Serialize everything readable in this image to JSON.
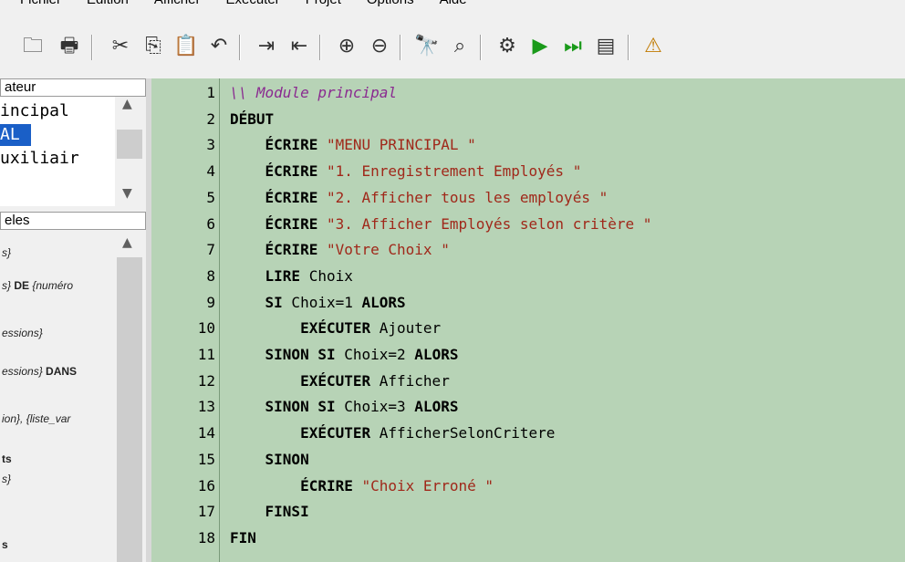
{
  "menubar": {
    "items": [
      "Fichier",
      "Édition",
      "Afficher",
      "Exécuter",
      "Projet",
      "Options",
      "Aide"
    ]
  },
  "toolbar": {
    "buttons": [
      {
        "icon": "open-folder-icon",
        "glyph": "🗀"
      },
      {
        "icon": "print-icon",
        "glyph": "🖶"
      },
      {
        "icon": "cut-icon",
        "glyph": "✂"
      },
      {
        "icon": "copy-icon",
        "glyph": "⎘"
      },
      {
        "icon": "paste-icon",
        "glyph": "📋"
      },
      {
        "icon": "undo-icon",
        "glyph": "↶"
      },
      {
        "icon": "indent-icon",
        "glyph": "⇥"
      },
      {
        "icon": "outdent-icon",
        "glyph": "⇤"
      },
      {
        "icon": "zoom-in-icon",
        "glyph": "⊕"
      },
      {
        "icon": "zoom-out-icon",
        "glyph": "⊖"
      },
      {
        "icon": "find-icon",
        "glyph": "🔭"
      },
      {
        "icon": "replace-icon",
        "glyph": "⌕"
      },
      {
        "icon": "compile-icon",
        "glyph": "⚙"
      },
      {
        "icon": "run-icon",
        "glyph": "▶"
      },
      {
        "icon": "step-icon",
        "glyph": "⏭"
      },
      {
        "icon": "output-icon",
        "glyph": "▤"
      },
      {
        "icon": "help-icon",
        "glyph": "⚠"
      }
    ]
  },
  "left": {
    "list1_header": "ateur",
    "list1_items": [
      "incipal",
      "AL",
      "uxiliair",
      ""
    ],
    "list2_header": "eles",
    "list2_items": [
      {
        "text": "s}",
        "bold": ""
      },
      {
        "text": "s} ",
        "bold": "DE",
        "tail": " {numéro"
      },
      {
        "text": "essions}",
        "bold": ""
      },
      {
        "text": "essions} ",
        "bold": "DANS",
        "tail": ""
      },
      {
        "text": "ion}, {liste_var",
        "bold": ""
      },
      {
        "text": "",
        "bold": "ts"
      },
      {
        "text": "s}",
        "bold": ""
      },
      {
        "text": "",
        "bold": "s"
      }
    ]
  },
  "editor": {
    "lines": [
      {
        "n": "1",
        "tokens": [
          {
            "t": "cmt",
            "v": "\\\\ Module principal"
          }
        ]
      },
      {
        "n": "2",
        "tokens": [
          {
            "t": "kw",
            "v": "DÉBUT"
          }
        ]
      },
      {
        "n": "3",
        "tokens": [
          {
            "t": "id",
            "v": "    "
          },
          {
            "t": "kw",
            "v": "ÉCRIRE"
          },
          {
            "t": "id",
            "v": " "
          },
          {
            "t": "str",
            "v": "\"MENU PRINCIPAL \""
          }
        ]
      },
      {
        "n": "4",
        "tokens": [
          {
            "t": "id",
            "v": "    "
          },
          {
            "t": "kw",
            "v": "ÉCRIRE"
          },
          {
            "t": "id",
            "v": " "
          },
          {
            "t": "str",
            "v": "\"1. Enregistrement Employés \""
          }
        ]
      },
      {
        "n": "5",
        "tokens": [
          {
            "t": "id",
            "v": "    "
          },
          {
            "t": "kw",
            "v": "ÉCRIRE"
          },
          {
            "t": "id",
            "v": " "
          },
          {
            "t": "str",
            "v": "\"2. Afficher tous les employés \""
          }
        ]
      },
      {
        "n": "6",
        "tokens": [
          {
            "t": "id",
            "v": "    "
          },
          {
            "t": "kw",
            "v": "ÉCRIRE"
          },
          {
            "t": "id",
            "v": " "
          },
          {
            "t": "str",
            "v": "\"3. Afficher Employés selon critère \""
          }
        ]
      },
      {
        "n": "7",
        "tokens": [
          {
            "t": "id",
            "v": "    "
          },
          {
            "t": "kw",
            "v": "ÉCRIRE"
          },
          {
            "t": "id",
            "v": " "
          },
          {
            "t": "str",
            "v": "\"Votre Choix \""
          }
        ]
      },
      {
        "n": "8",
        "tokens": [
          {
            "t": "id",
            "v": "    "
          },
          {
            "t": "kw",
            "v": "LIRE"
          },
          {
            "t": "id",
            "v": " Choix"
          }
        ]
      },
      {
        "n": "9",
        "tokens": [
          {
            "t": "id",
            "v": "    "
          },
          {
            "t": "kw",
            "v": "SI"
          },
          {
            "t": "id",
            "v": " Choix=1 "
          },
          {
            "t": "kw",
            "v": "ALORS"
          }
        ]
      },
      {
        "n": "10",
        "tokens": [
          {
            "t": "id",
            "v": "        "
          },
          {
            "t": "kw",
            "v": "EXÉCUTER"
          },
          {
            "t": "id",
            "v": " Ajouter"
          }
        ]
      },
      {
        "n": "11",
        "tokens": [
          {
            "t": "id",
            "v": "    "
          },
          {
            "t": "kw",
            "v": "SINON SI"
          },
          {
            "t": "id",
            "v": " Choix=2 "
          },
          {
            "t": "kw",
            "v": "ALORS"
          }
        ]
      },
      {
        "n": "12",
        "tokens": [
          {
            "t": "id",
            "v": "        "
          },
          {
            "t": "kw",
            "v": "EXÉCUTER"
          },
          {
            "t": "id",
            "v": " Afficher"
          }
        ]
      },
      {
        "n": "13",
        "tokens": [
          {
            "t": "id",
            "v": "    "
          },
          {
            "t": "kw",
            "v": "SINON SI"
          },
          {
            "t": "id",
            "v": " Choix=3 "
          },
          {
            "t": "kw",
            "v": "ALORS"
          }
        ]
      },
      {
        "n": "14",
        "tokens": [
          {
            "t": "id",
            "v": "        "
          },
          {
            "t": "kw",
            "v": "EXÉCUTER"
          },
          {
            "t": "id",
            "v": " AfficherSelonCritere"
          }
        ]
      },
      {
        "n": "15",
        "tokens": [
          {
            "t": "id",
            "v": "    "
          },
          {
            "t": "kw",
            "v": "SINON"
          }
        ]
      },
      {
        "n": "16",
        "tokens": [
          {
            "t": "id",
            "v": "        "
          },
          {
            "t": "kw",
            "v": "ÉCRIRE"
          },
          {
            "t": "id",
            "v": " "
          },
          {
            "t": "str",
            "v": "\"Choix Erroné \""
          }
        ]
      },
      {
        "n": "17",
        "tokens": [
          {
            "t": "id",
            "v": "    "
          },
          {
            "t": "kw",
            "v": "FINSI"
          }
        ]
      },
      {
        "n": "18",
        "tokens": [
          {
            "t": "kw",
            "v": "FIN"
          }
        ]
      }
    ]
  },
  "colors": {
    "editor_bg": "#b7d3b6",
    "string": "#a0281a",
    "comment": "#8a2a90",
    "selection": "#1a5fc7"
  }
}
